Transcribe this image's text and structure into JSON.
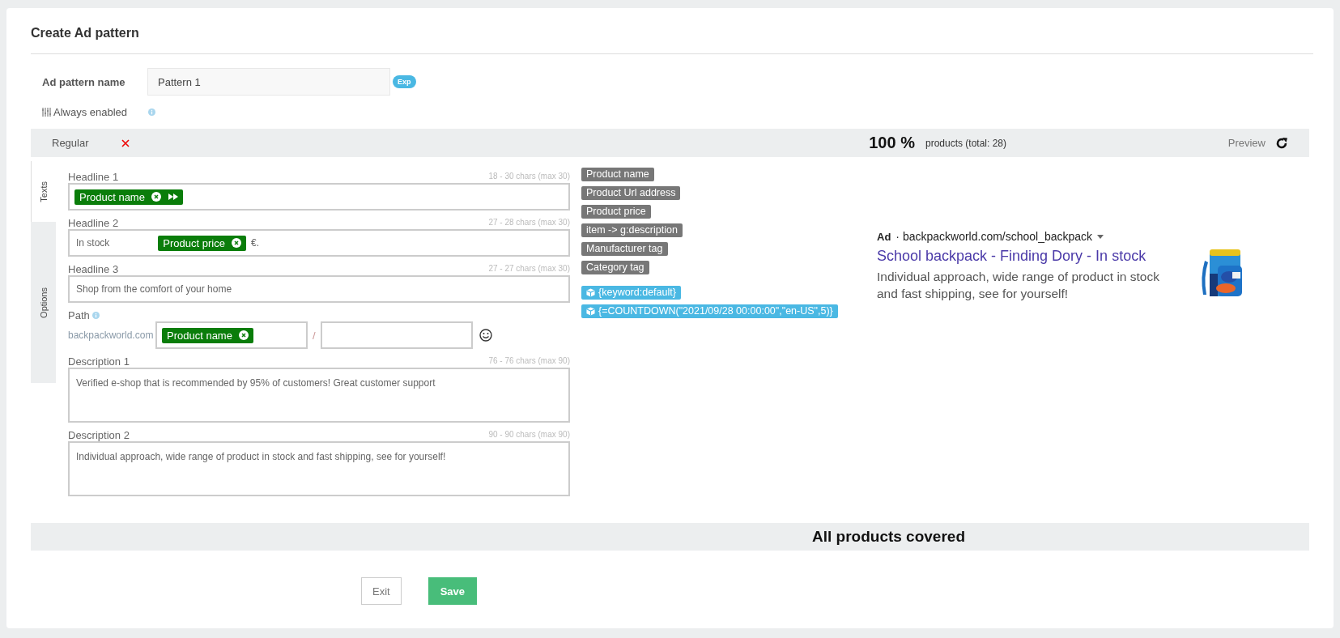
{
  "title": "Create Ad pattern",
  "name_field": {
    "label": "Ad pattern name",
    "value": "Pattern 1",
    "badge": "Exp"
  },
  "always_enabled": {
    "label": "Always enabled"
  },
  "pattern_bar": {
    "name": "Regular",
    "coverage": "100 %",
    "products": "products (total: 28)",
    "preview": "Preview"
  },
  "side_tabs": [
    {
      "label": "Texts",
      "selected": true
    },
    {
      "label": "Options",
      "selected": false
    }
  ],
  "fields": [
    {
      "label": "Headline 1",
      "counter": "18 - 30 chars (max 30)",
      "kind": "single",
      "parts": [
        {
          "kind": "chip",
          "text": "Product name",
          "forward": true
        }
      ]
    },
    {
      "label": "Headline 2",
      "counter": "27 - 28 chars (max 30)",
      "kind": "single",
      "parts": [
        {
          "kind": "text",
          "text": "In stock"
        },
        {
          "kind": "gap"
        },
        {
          "kind": "chip",
          "text": "Product price",
          "forward": false
        },
        {
          "kind": "text",
          "text": "€."
        }
      ]
    },
    {
      "label": "Headline 3",
      "counter": "27 - 27 chars (max 30)",
      "kind": "single",
      "parts": [
        {
          "kind": "text",
          "text": "Shop from the comfort of your home"
        }
      ]
    },
    {
      "label": "Path",
      "kind": "path",
      "domain": "backpackworld.com",
      "separator": "/",
      "first_segment": {
        "parts": [
          {
            "kind": "chip",
            "text": "Product name",
            "forward": false
          }
        ]
      }
    },
    {
      "label": "Description 1",
      "counter": "76 - 76 chars (max 90)",
      "kind": "multi",
      "parts": [
        {
          "kind": "text",
          "text": "Verified e-shop that is recommended by 95% of customers! Great customer support"
        }
      ]
    },
    {
      "label": "Description 2",
      "counter": "90 - 90 chars (max 90)",
      "kind": "multi",
      "parts": [
        {
          "kind": "text",
          "text": "Individual approach, wide range of product in stock and fast shipping, see for yourself!"
        }
      ]
    }
  ],
  "variables": [
    {
      "kind": "feed",
      "text": "Product name"
    },
    {
      "kind": "feed",
      "text": "Product Url address"
    },
    {
      "kind": "feed",
      "text": "Product price"
    },
    {
      "kind": "feed",
      "text": "item -> g:description"
    },
    {
      "kind": "feed",
      "text": "Manufacturer tag"
    },
    {
      "kind": "feed",
      "text": "Category tag"
    },
    {
      "kind": "function",
      "text": "{keyword:default}"
    },
    {
      "kind": "function",
      "text": "{=COUNTDOWN(\"2021/09/28 00:00:00\",\"en-US\",5)}"
    }
  ],
  "ad_preview": {
    "label": "Ad",
    "url": "· backpackworld.com/school_backpack",
    "headline": "School backpack - Finding Dory - In stock",
    "description": "Individual approach, wide range of product in stock and fast shipping, see for yourself!"
  },
  "coverage_bar": "All products covered",
  "buttons": [
    {
      "kind": "secondary",
      "label": "Exit"
    },
    {
      "kind": "primary",
      "label": "Save"
    }
  ]
}
